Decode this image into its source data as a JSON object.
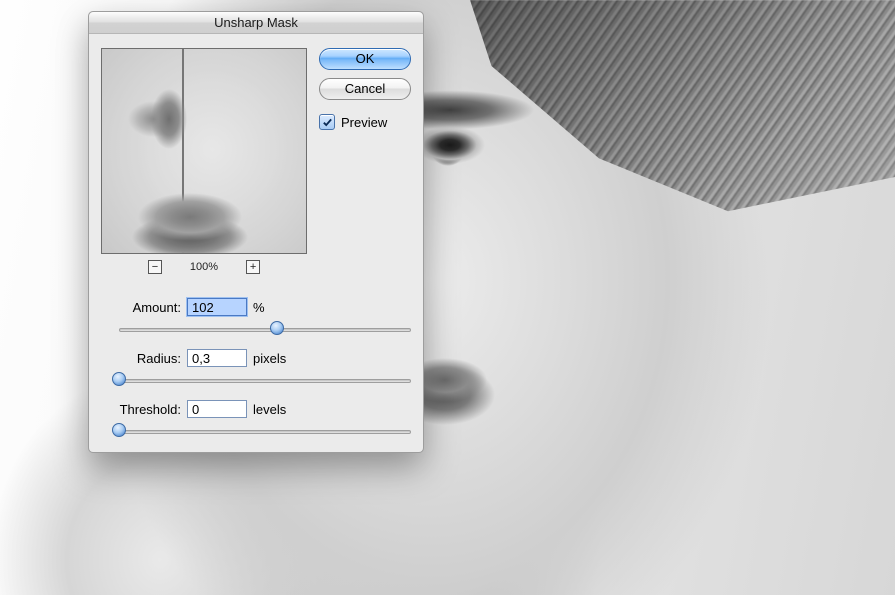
{
  "dialog": {
    "title": "Unsharp Mask",
    "ok_label": "OK",
    "cancel_label": "Cancel",
    "preview_checkbox_label": "Preview",
    "preview_checked": true,
    "zoom": {
      "level_label": "100%",
      "minus_label": "−",
      "plus_label": "+"
    },
    "params": {
      "amount": {
        "label": "Amount:",
        "value": "102",
        "unit": "%",
        "slider_pos": 0.54
      },
      "radius": {
        "label": "Radius:",
        "value": "0,3",
        "unit": "pixels",
        "slider_pos": 0.0
      },
      "threshold": {
        "label": "Threshold:",
        "value": "0",
        "unit": "levels",
        "slider_pos": 0.0
      }
    }
  }
}
